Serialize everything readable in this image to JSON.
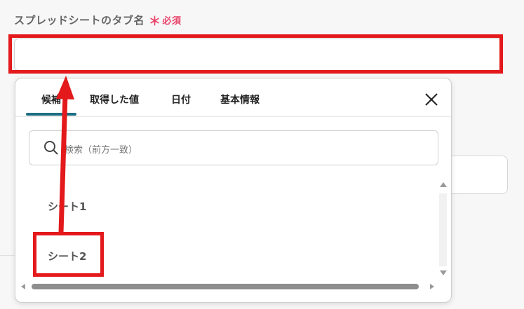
{
  "field": {
    "label": "スプレッドシートのタブ名",
    "required_mark": "＊",
    "required_text": "必須",
    "value": ""
  },
  "dropdown": {
    "tabs": [
      {
        "label": "候補",
        "active": true
      },
      {
        "label": "取得した値",
        "active": false
      },
      {
        "label": "日付",
        "active": false
      },
      {
        "label": "基本情報",
        "active": false
      }
    ],
    "close_icon": "close-icon",
    "search": {
      "icon": "search-icon",
      "placeholder": "検索（前方一致）"
    },
    "items": [
      {
        "label": "シート1"
      },
      {
        "label": "シート2"
      }
    ]
  },
  "colors": {
    "annotation": "#e3191c",
    "required": "#e8446a",
    "tab_accent": "#1d6d83"
  }
}
